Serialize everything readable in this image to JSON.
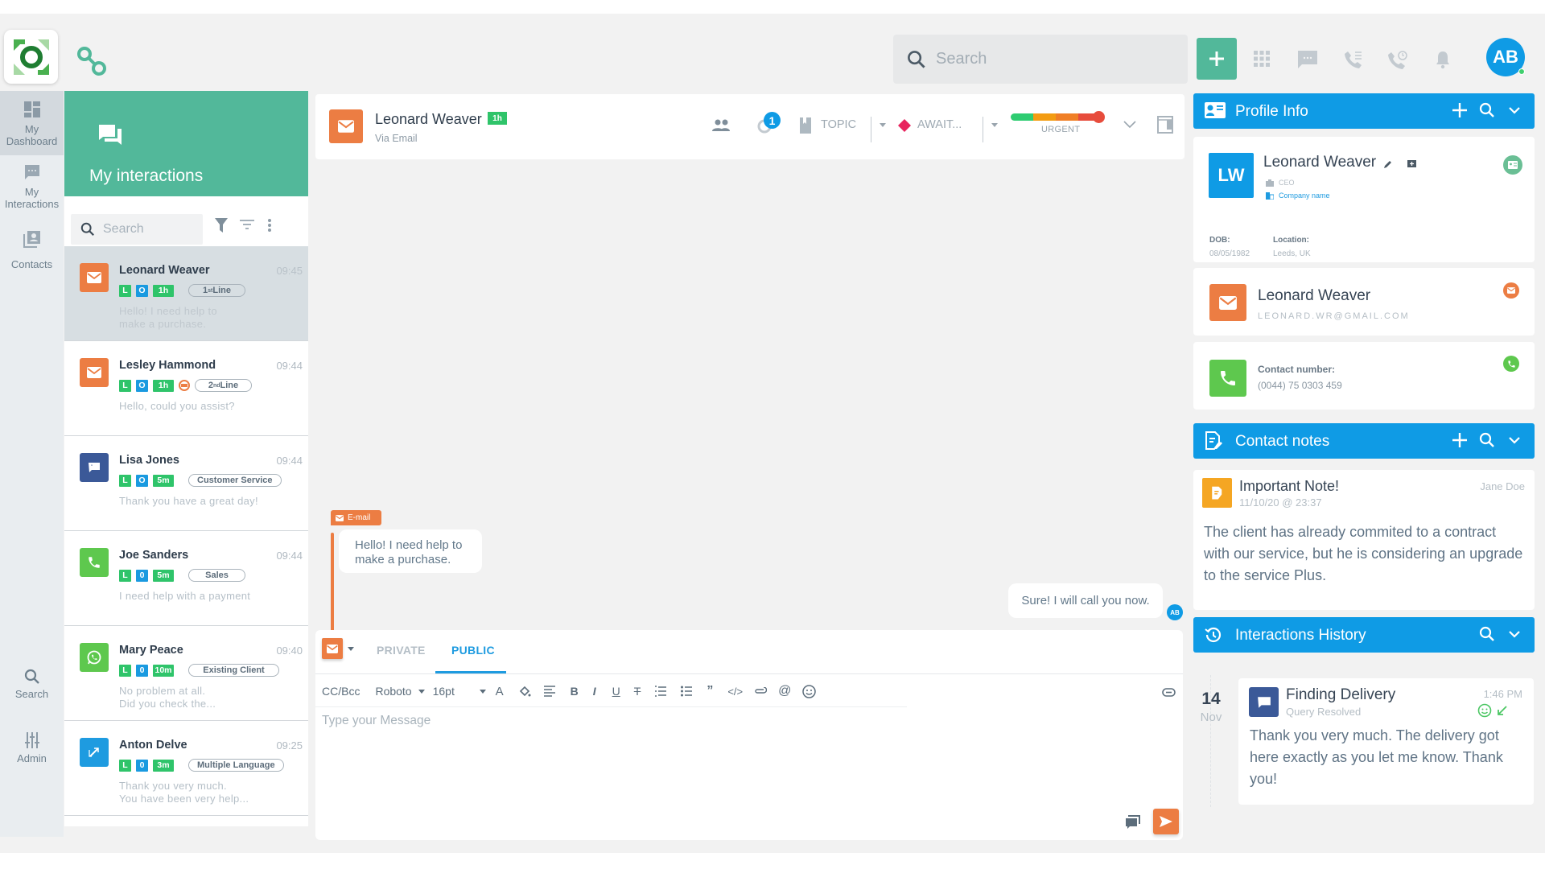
{
  "top_bar": {
    "search_placeholder": "Search",
    "user_initials": "AB",
    "icons": [
      "add-icon",
      "apps-grid-icon",
      "chat-icon",
      "call-list-icon",
      "call-history-icon",
      "bell-icon"
    ]
  },
  "sidebar": {
    "items": [
      {
        "label": "My Dashboard",
        "icon": "dashboard-icon",
        "active": true
      },
      {
        "label": "My Interactions",
        "icon": "message-icon",
        "active": false
      },
      {
        "label": "Contacts",
        "icon": "contacts-icon",
        "active": false
      },
      {
        "label": "Search",
        "icon": "search-icon",
        "active": false
      },
      {
        "label": "Admin",
        "icon": "sliders-icon",
        "active": false
      }
    ]
  },
  "interactions_panel": {
    "title": "My interactions",
    "search_placeholder": "Search",
    "items": [
      {
        "name": "Leonard Weaver",
        "time": "09:45",
        "channel": "email",
        "tags": [
          "L",
          "O",
          "1h"
        ],
        "queue": "1st Line",
        "preview": "Hello! I need help to\nmake a purchase.",
        "selected": true
      },
      {
        "name": "Lesley Hammond",
        "time": "09:44",
        "channel": "email",
        "tags": [
          "L",
          "O",
          "1h"
        ],
        "queue": "2nd Line",
        "preview": "Hello, could you assist?",
        "has_alert_icon": true
      },
      {
        "name": "Lisa Jones",
        "time": "09:44",
        "channel": "chat",
        "tags": [
          "L",
          "O",
          "5m"
        ],
        "queue": "Customer Service",
        "preview": "Thank you have a great day!"
      },
      {
        "name": "Joe Sanders",
        "time": "09:44",
        "channel": "phone",
        "tags": [
          "L",
          "0",
          "5m"
        ],
        "queue": "Sales",
        "preview": "I need help with a payment"
      },
      {
        "name": "Mary Peace",
        "time": "09:40",
        "channel": "whatsapp",
        "tags": [
          "L",
          "0",
          "10m"
        ],
        "queue": "Existing Client",
        "preview": "No problem at all.\nDid you check the..."
      },
      {
        "name": "Anton Delve",
        "time": "09:25",
        "channel": "translate",
        "tags": [
          "L",
          "0",
          "3m"
        ],
        "queue": "Multiple Language",
        "preview": "Thank you very much.\nYou have been very help..."
      }
    ]
  },
  "conversation": {
    "contact_name": "Leonard Weaver",
    "age_badge": "1h",
    "via": "Via Email",
    "notification_count": "1",
    "topic_label": "TOPIC",
    "status_label": "AWAIT...",
    "urgency_label": "URGENT",
    "urgency_level": 1.0,
    "messages": [
      {
        "direction": "in",
        "channel_label": "E-mail",
        "text": "Hello! I need help to\nmake a purchase."
      },
      {
        "direction": "out",
        "text": "Sure! I will call you now.",
        "sender_initials": "AB"
      }
    ]
  },
  "composer": {
    "tabs": [
      {
        "label": "PRIVATE",
        "active": false
      },
      {
        "label": "PUBLIC",
        "active": true
      }
    ],
    "cc_label": "CC/Bcc",
    "font": "Roboto",
    "size": "16pt",
    "placeholder": "Type your Message"
  },
  "profile_info": {
    "title": "Profile Info",
    "initials": "LW",
    "name": "Leonard Weaver",
    "role": "CEO",
    "company": "Company name",
    "dob_label": "DOB:",
    "dob": "08/05/1982",
    "location_label": "Location:",
    "location": "Leeds, UK",
    "email_name": "Leonard Weaver",
    "email": "LEONARD.WR@GMAIL.COM",
    "phone_label": "Contact number:",
    "phone": "(0044) 75 0303 459"
  },
  "contact_notes": {
    "title": "Contact notes",
    "note_title": "Important Note!",
    "note_date": "11/10/20 @ 23:37",
    "note_author": "Jane Doe",
    "note_text": "The client has already commited to a contract with our service, but he is considering an upgrade to the service Plus."
  },
  "history": {
    "title": "Interactions History",
    "day": "14",
    "month": "Nov",
    "item_title": "Finding Delivery",
    "item_status": "Query Resolved",
    "item_time": "1:46 PM",
    "item_text": "Thank you very much. The delivery got here exactly as you let me know. Thank you!"
  },
  "colors": {
    "brand_green": "#52b89a",
    "accent_blue": "#0f9be5",
    "email_orange": "#ec7d43",
    "tag_green": "#2fc46a",
    "phone_green": "#5ec84e"
  }
}
